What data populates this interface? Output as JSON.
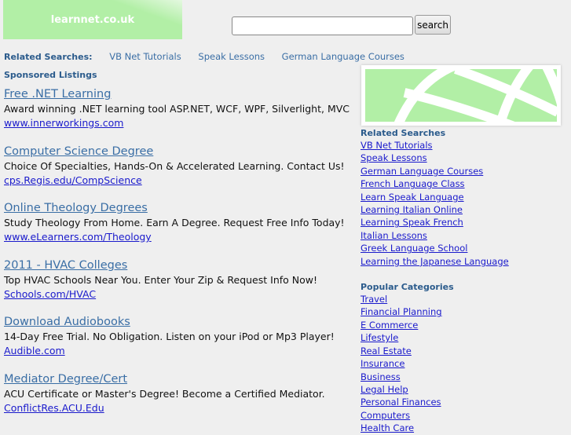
{
  "logo": "learnnet.co.uk",
  "search": {
    "value": "",
    "button": "search"
  },
  "related_bar": {
    "label": "Related Searches:",
    "links": [
      "VB Net Tutorials",
      "Speak Lessons",
      "German Language Courses"
    ]
  },
  "sponsored_label": "Sponsored Listings",
  "ads": [
    {
      "title": "Free .NET Learning",
      "desc": "Award winning .NET learning tool ASP.NET, WCF, WPF, Silverlight, MVC",
      "url": "www.innerworkings.com"
    },
    {
      "title": "Computer Science Degree",
      "desc": "Choice Of Specialties, Hands-On & Accelerated Learning. Contact Us!",
      "url": "cps.Regis.edu/CompScience"
    },
    {
      "title": "Online Theology Degrees",
      "desc": "Study Theology From Home. Earn A Degree. Request Free Info Today!",
      "url": "www.eLearners.com/Theology"
    },
    {
      "title": "2011 - HVAC Colleges",
      "desc": "Top HVAC Schools Near You. Enter Your Zip & Request Info Now!",
      "url": "Schools.com/HVAC"
    },
    {
      "title": "Download Audiobooks",
      "desc": "14-Day Free Trial. No Obligation. Listen on your iPod or Mp3 Player!",
      "url": "Audible.com"
    },
    {
      "title": "Mediator Degree/Cert",
      "desc": "ACU Certificate or Master's Degree! Become a Certified Mediator.",
      "url": "ConflictRes.ACU.Edu"
    }
  ],
  "sidebar": {
    "related_title": "Related Searches",
    "related": [
      "VB Net Tutorials",
      "Speak Lessons",
      "German Language Courses",
      "French Language Class",
      "Learn Speak Language",
      "Learning Italian Online",
      "Learning Speak French",
      "Italian Lessons",
      "Greek Language School",
      "Learning the Japanese Language"
    ],
    "popular_title": "Popular Categories",
    "popular": [
      "Travel",
      "Financial Planning",
      "E Commerce",
      "Lifestyle",
      "Real Estate",
      "Insurance",
      "Business",
      "Legal Help",
      "Personal Finances",
      "Computers",
      "Health Care"
    ]
  }
}
